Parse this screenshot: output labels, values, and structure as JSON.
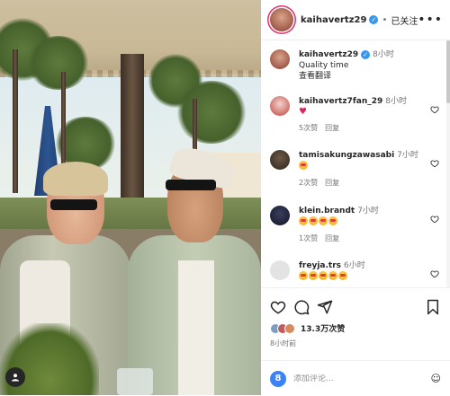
{
  "post": {
    "username": "kaihavertz29",
    "follow_state": "已关注",
    "separator": "•",
    "more": "•••"
  },
  "caption": {
    "username": "kaihavertz29",
    "time": "8小时",
    "text": "Quality time",
    "translate": "查看翻译"
  },
  "comments": [
    {
      "username": "kaihavertz7fan_29",
      "time": "8小时",
      "likes": "5次赞",
      "reply": "回复",
      "emoji_count": 0
    },
    {
      "username": "tamisakungzawasabi",
      "time": "7小时",
      "likes": "2次赞",
      "reply": "回复",
      "emoji_count": 1
    },
    {
      "username": "klein.brandt",
      "time": "7小时",
      "likes": "1次赞",
      "reply": "回复",
      "emoji_count": 4
    },
    {
      "username": "freyja.trs",
      "time": "6小时",
      "likes": "",
      "reply": "",
      "emoji_count": 5
    }
  ],
  "icons": {
    "like": "heart-icon",
    "comment": "comment-icon",
    "share": "send-icon",
    "save": "bookmark-icon",
    "emoji": "smiley-icon",
    "verified": "verified-badge-icon",
    "user_tag": "user-tag-icon",
    "comment_heart": "heart-outline-icon"
  },
  "stats": {
    "likes": "13.3万次赞",
    "time_ago": "8小时前"
  },
  "composer": {
    "placeholder": "添加评论..."
  },
  "colors": {
    "verified": "#3797f0",
    "story_ring": "#e1306c",
    "text_primary": "#262626",
    "text_secondary": "#737373",
    "heart": "#e0245e"
  }
}
